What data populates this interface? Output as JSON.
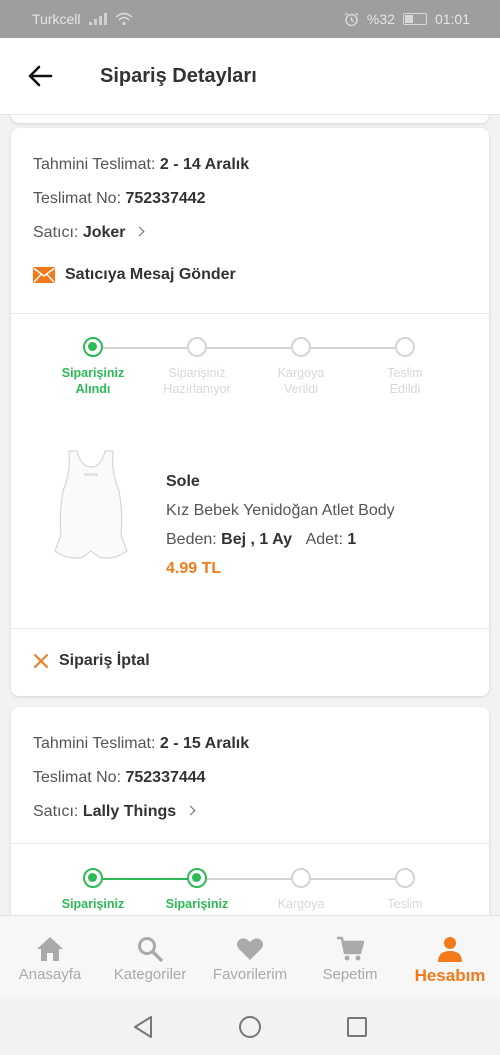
{
  "status_bar": {
    "carrier": "Turkcell",
    "battery": "%32",
    "time": "01:01"
  },
  "header": {
    "title": "Sipariş Detayları"
  },
  "orders": [
    {
      "delivery_label": "Tahmini Teslimat:",
      "delivery_value": "2 - 14 Aralık",
      "tracking_label": "Teslimat No:",
      "tracking_value": "752337442",
      "seller_label": "Satıcı:",
      "seller_value": "Joker",
      "message_label": "Satıcıya Mesaj Gönder",
      "steps": [
        {
          "line1": "Siparişiniz",
          "line2": "Alındı",
          "done": true
        },
        {
          "line1": "Siparişiniz",
          "line2": "Hazırlanıyor",
          "done": false
        },
        {
          "line1": "Kargoya",
          "line2": "Verildi",
          "done": false
        },
        {
          "line1": "Teslim",
          "line2": "Edildi",
          "done": false
        }
      ],
      "product": {
        "brand": "Sole",
        "name": "Kız Bebek Yenidoğan Atlet Body",
        "size_label": "Beden:",
        "size_value": "Bej , 1 Ay",
        "qty_label": "Adet:",
        "qty_value": "1",
        "price": "4.99 TL"
      },
      "cancel_label": "Sipariş İptal"
    },
    {
      "delivery_label": "Tahmini Teslimat:",
      "delivery_value": "2 - 15 Aralık",
      "tracking_label": "Teslimat No:",
      "tracking_value": "752337444",
      "seller_label": "Satıcı:",
      "seller_value": "Lally Things",
      "steps": [
        {
          "line1": "Siparişiniz",
          "done": true
        },
        {
          "line1": "Siparişiniz",
          "done": true
        },
        {
          "line1": "Kargoya",
          "done": false
        },
        {
          "line1": "Teslim",
          "done": false
        }
      ]
    }
  ],
  "bottom_nav": [
    {
      "label": "Anasayfa",
      "icon": "home-icon",
      "active": false
    },
    {
      "label": "Kategoriler",
      "icon": "search-icon",
      "active": false
    },
    {
      "label": "Favorilerim",
      "icon": "heart-icon",
      "active": false
    },
    {
      "label": "Sepetim",
      "icon": "cart-icon",
      "active": false
    },
    {
      "label": "Hesabım",
      "icon": "user-icon",
      "active": true
    }
  ],
  "colors": {
    "accent": "#f27a1a",
    "success": "#2dba56",
    "inactive": "#d4d4d4"
  }
}
